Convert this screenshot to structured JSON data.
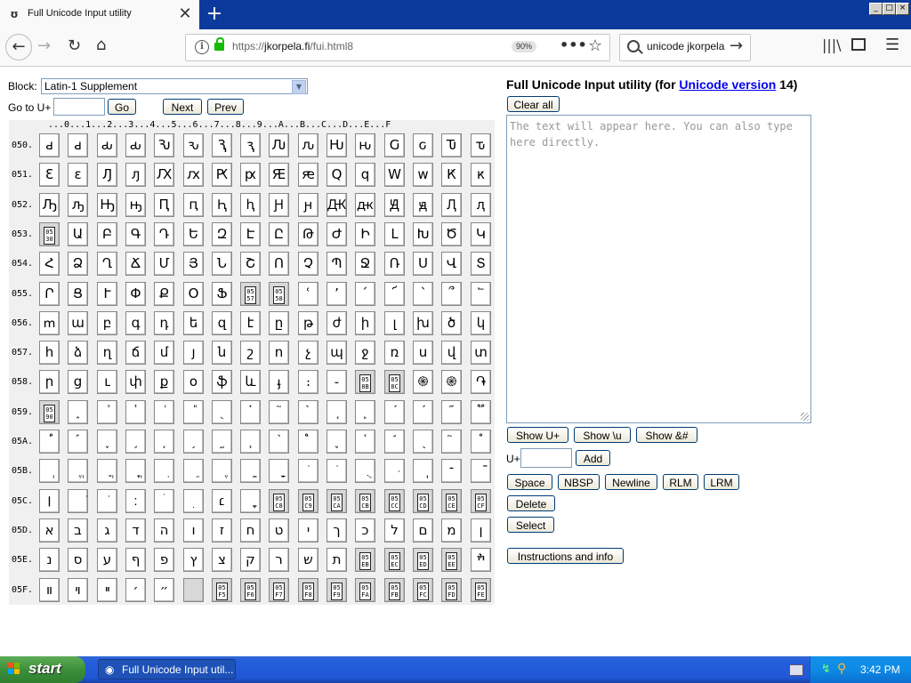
{
  "browser": {
    "tab_title": "Full Unicode Input utility",
    "tab_close": "✕",
    "new_tab": "+",
    "url_domain": "jkorpela.fi",
    "url_prefix": "https://",
    "url_path": "/fui.html8",
    "zoom": "90%",
    "search_query": "‫unicode jkorpela",
    "window_min": "_",
    "window_max": "□",
    "window_close": "×"
  },
  "page": {
    "block_label": "Block:",
    "block_value": "Latin-1 Supplement",
    "goto_label": "Go to U+",
    "goto_value": "",
    "go_button": "Go",
    "next_button": "Next",
    "prev_button": "Prev",
    "title_prefix": "Full Unicode Input utility (for ",
    "title_link": "Unicode version",
    "title_suffix": " 14)",
    "clear_button": "Clear all",
    "output_placeholder": "The text will appear here. You can also type here directly.",
    "show_uplus": "Show U+",
    "show_backslash_u": "Show \\u",
    "show_amp": "Show &#",
    "uplus_label": "U+",
    "add_button": "Add",
    "space_button": "Space",
    "nbsp_button": "NBSP",
    "newline_button": "Newline",
    "rlm_button": "RLM",
    "lrm_button": "LRM",
    "delete_button": "Delete",
    "select_button": "Select",
    "info_button": "Instructions and info"
  },
  "grid": {
    "column_header": "...0...1...2...3...4...5...6...7...8...9...A...B...C...D...E...F",
    "rows": [
      {
        "label": "050.",
        "cells": [
          "ԁ",
          "ԁ",
          "ԃ",
          "ԃ",
          "Ԅ",
          "ԅ",
          "Ԇ",
          "ԇ",
          "Ԉ",
          "ԉ",
          "Ԋ",
          "ԋ",
          "Ԍ",
          "ԍ",
          "Ԏ",
          "ԏ"
        ]
      },
      {
        "label": "051.",
        "cells": [
          "Ԑ",
          "ԑ",
          "Ԓ",
          "ԓ",
          "Ԕ",
          "ԕ",
          "Ԗ",
          "ԗ",
          "Ԙ",
          "ԙ",
          "Ԛ",
          "ԛ",
          "Ԝ",
          "ԝ",
          "Ԟ",
          "ԟ"
        ]
      },
      {
        "label": "052.",
        "cells": [
          "Ԡ",
          "ԡ",
          "Ԣ",
          "ԣ",
          "Ԥ",
          "ԥ",
          "Ԧ",
          "ԧ",
          "Ԩ",
          "ԩ",
          "Ԫ",
          "ԫ",
          "Ԭ",
          "ԭ",
          "Ԯ",
          "ԯ"
        ]
      },
      {
        "label": "053.",
        "cells": [
          "#0530",
          "Ա",
          "Բ",
          "Գ",
          "Դ",
          "Ե",
          "Զ",
          "Է",
          "Ը",
          "Թ",
          "Ժ",
          "Ի",
          "Լ",
          "Խ",
          "Ծ",
          "Կ"
        ]
      },
      {
        "label": "054.",
        "cells": [
          "Հ",
          "Ձ",
          "Ղ",
          "Ճ",
          "Մ",
          "Յ",
          "Ն",
          "Շ",
          "Ո",
          "Չ",
          "Պ",
          "Ջ",
          "Ռ",
          "Ս",
          "Վ",
          "Տ"
        ]
      },
      {
        "label": "055.",
        "cells": [
          "Ր",
          "Ց",
          "Ւ",
          "Փ",
          "Ք",
          "Օ",
          "Ֆ",
          "#0557",
          "#0558",
          "ՙ",
          "՚",
          "՛",
          "՜",
          "՝",
          "՞",
          "՟"
        ]
      },
      {
        "label": "056.",
        "cells": [
          "ՠ",
          "ա",
          "բ",
          "գ",
          "դ",
          "ե",
          "զ",
          "է",
          "ը",
          "թ",
          "ժ",
          "ի",
          "լ",
          "խ",
          "ծ",
          "կ"
        ]
      },
      {
        "label": "057.",
        "cells": [
          "հ",
          "ձ",
          "ղ",
          "ճ",
          "մ",
          "յ",
          "ն",
          "շ",
          "ո",
          "չ",
          "պ",
          "ջ",
          "ռ",
          "ս",
          "վ",
          "տ"
        ]
      },
      {
        "label": "058.",
        "cells": [
          "ր",
          "ց",
          "ւ",
          "փ",
          "ք",
          "օ",
          "ֆ",
          "և",
          "ֈ",
          "։",
          "֊",
          "#058B",
          "#058C",
          "֍",
          "֎",
          "֏"
        ]
      },
      {
        "label": "059.",
        "cells": [
          "#0590",
          "֑",
          "֒",
          "֓",
          "֔",
          "֕",
          "֖",
          "֗",
          "֘",
          "֙",
          "֚",
          "֛",
          "֜",
          "֝",
          "֞",
          "֟"
        ]
      },
      {
        "label": "05A.",
        "cells": [
          "֠",
          "֡",
          "֢",
          "֣",
          "֤",
          "֥",
          "֦",
          "֧",
          "֨",
          "֩",
          "֪",
          "֫",
          "֬",
          "֭",
          "֮",
          "֯"
        ]
      },
      {
        "label": "05B.",
        "cells": [
          "ְ",
          "ֱ",
          "ֲ",
          "ֳ",
          "ִ",
          "ֵ",
          "ֶ",
          "ַ",
          "ָ",
          "ֹ",
          "ֺ",
          "ֻ",
          "ּ",
          "ֽ",
          "־",
          "ֿ"
        ]
      },
      {
        "label": "05C.",
        "cells": [
          "׀",
          "ׁ",
          "ׂ",
          "׃",
          "ׄ",
          "ׅ",
          "׆",
          "ׇ",
          "#05C8",
          "#05C9",
          "#05CA",
          "#05CB",
          "#05CC",
          "#05CD",
          "#05CE",
          "#05CF"
        ]
      },
      {
        "label": "05D.",
        "cells": [
          "א",
          "ב",
          "ג",
          "ד",
          "ה",
          "ו",
          "ז",
          "ח",
          "ט",
          "י",
          "ך",
          "כ",
          "ל",
          "ם",
          "מ",
          "ן"
        ]
      },
      {
        "label": "05E.",
        "cells": [
          "נ",
          "ס",
          "ע",
          "ף",
          "פ",
          "ץ",
          "צ",
          "ק",
          "ר",
          "ש",
          "ת",
          "#05EB",
          "#05EC",
          "#05ED",
          "#05EE",
          "ׯ"
        ]
      },
      {
        "label": "05F.",
        "cells": [
          "װ",
          "ױ",
          "ײ",
          "׳",
          "״",
          "",
          "#05F5",
          "#05F6",
          "#05F7",
          "#05F8",
          "#05F9",
          "#05FA",
          "#05FB",
          "#05FC",
          "#05FD",
          "#05FE"
        ]
      }
    ]
  },
  "taskbar": {
    "start_label": "start",
    "task_label": "Full Unicode Input util...",
    "clock": "3:42 PM"
  },
  "colors": {
    "titlebar": "#0b3a9c",
    "link": "#0000ee",
    "reserved_cell": "#d8d8d8",
    "taskbar": "#245edb",
    "start_green": "#3c8f3b"
  },
  "icons": {
    "back": "back-arrow-icon",
    "forward": "forward-arrow-icon",
    "reload": "reload-icon",
    "home": "home-icon",
    "library": "library-icon",
    "sidebar": "sidebar-icon",
    "menu": "hamburger-menu-icon"
  }
}
